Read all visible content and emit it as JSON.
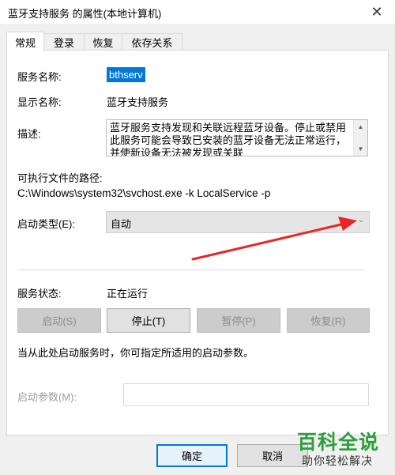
{
  "window": {
    "title": "蓝牙支持服务 的属性(本地计算机)",
    "close_glyph": "✕"
  },
  "tabs": [
    {
      "label": "常规",
      "active": true
    },
    {
      "label": "登录"
    },
    {
      "label": "恢复"
    },
    {
      "label": "依存关系"
    }
  ],
  "general": {
    "service_name_label": "服务名称:",
    "service_name_value": "bthserv",
    "display_name_label": "显示名称:",
    "display_name_value": "蓝牙支持服务",
    "description_label": "描述:",
    "description_text": "蓝牙服务支持发现和关联远程蓝牙设备。停止或禁用此服务可能会导致已安装的蓝牙设备无法正常运行，并使新设备无法被发现或关联",
    "path_label": "可执行文件的路径:",
    "path_value": "C:\\Windows\\system32\\svchost.exe -k LocalService -p",
    "startup_type_label": "启动类型(E):",
    "startup_type_value": "自动",
    "status_label": "服务状态:",
    "status_value": "正在运行",
    "buttons": {
      "start": "启动(S)",
      "stop": "停止(T)",
      "pause": "暂停(P)",
      "resume": "恢复(R)"
    },
    "hint": "当从此处启动服务时，你可指定所适用的启动参数。",
    "params_label": "启动参数(M):",
    "params_value": ""
  },
  "footer": {
    "ok": "确定",
    "cancel": "取消"
  },
  "watermark": {
    "line1": "百科全说",
    "line2": "助你轻松解决"
  },
  "colors": {
    "accent": "#0078d7",
    "arrow": "#e8262a",
    "watermark": "#2d9f3a"
  }
}
